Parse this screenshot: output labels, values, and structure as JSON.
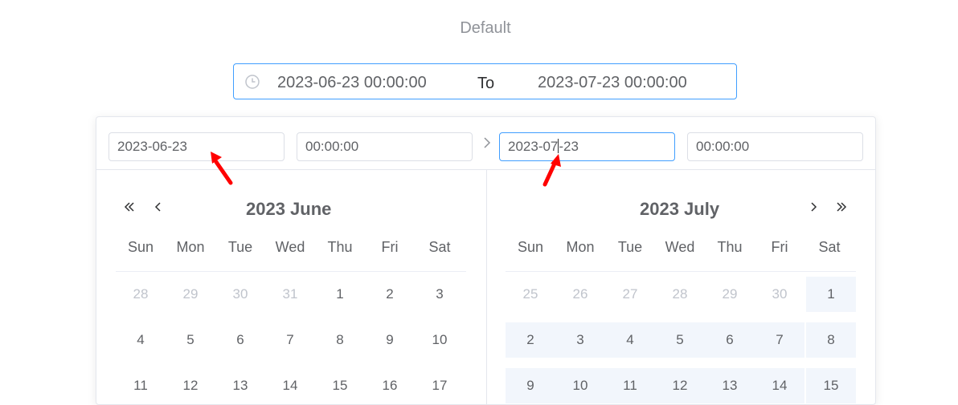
{
  "header": {
    "title": "Default"
  },
  "range": {
    "start": "2023-06-23 00:00:00",
    "separator": "To",
    "end": "2023-07-23 00:00:00"
  },
  "panel": {
    "left": {
      "date": "2023-06-23",
      "time": "00:00:00",
      "title": "2023 June"
    },
    "right": {
      "date_before_caret": "2023-07",
      "date_after_caret": "-23",
      "time": "00:00:00",
      "title": "2023 July"
    }
  },
  "weekdays": [
    "Sun",
    "Mon",
    "Tue",
    "Wed",
    "Thu",
    "Fri",
    "Sat"
  ],
  "june_rows": [
    [
      "28",
      "29",
      "30",
      "31",
      "1",
      "2",
      "3"
    ],
    [
      "4",
      "5",
      "6",
      "7",
      "8",
      "9",
      "10"
    ],
    [
      "11",
      "12",
      "13",
      "14",
      "15",
      "16",
      "17"
    ]
  ],
  "july_rows": [
    [
      "25",
      "26",
      "27",
      "28",
      "29",
      "30",
      "1"
    ],
    [
      "2",
      "3",
      "4",
      "5",
      "6",
      "7",
      "8"
    ],
    [
      "9",
      "10",
      "11",
      "12",
      "13",
      "14",
      "15"
    ]
  ],
  "colors": {
    "accent": "#409eff",
    "range_bg": "#f2f6fc",
    "annotation": "#ff0000"
  }
}
